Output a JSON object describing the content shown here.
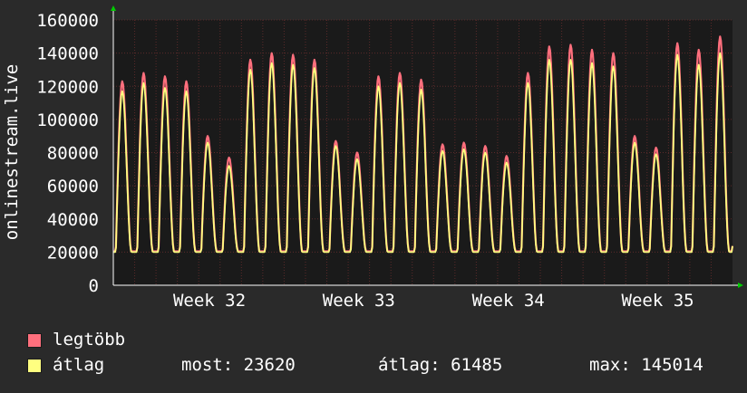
{
  "chart_data": {
    "type": "line",
    "ylabel": "onlinestream.live",
    "ylim": [
      0,
      160000
    ],
    "yticks": [
      0,
      20000,
      40000,
      60000,
      80000,
      100000,
      120000,
      140000,
      160000
    ],
    "xticks": [
      "Week 32",
      "Week 33",
      "Week 34",
      "Week 35"
    ],
    "grid": true,
    "daily_peaks": {
      "series": [
        {
          "name": "legtöbb",
          "color": "#ff6f7d",
          "values": [
            123000,
            128000,
            126000,
            123000,
            90000,
            77000,
            136000,
            140000,
            139000,
            136000,
            87000,
            80000,
            126000,
            128000,
            124000,
            85000,
            86000,
            84000,
            78000,
            128000,
            144000,
            145000,
            142000,
            140000,
            90000,
            83000,
            146000,
            142000,
            150000
          ]
        },
        {
          "name": "átlag",
          "color": "#ffff80",
          "values": [
            117000,
            122000,
            119000,
            117000,
            86000,
            72000,
            130000,
            134000,
            133000,
            131000,
            84000,
            76000,
            120000,
            122000,
            118000,
            81000,
            82000,
            80000,
            74000,
            122000,
            136000,
            136000,
            134000,
            132000,
            86000,
            79000,
            139000,
            133000,
            140000
          ]
        }
      ]
    },
    "daily_min": 20000,
    "last_value": 23620
  },
  "legend": {
    "items": [
      {
        "label": "legtöbb",
        "color": "#ff6f7d"
      },
      {
        "label": "átlag",
        "color": "#ffff80"
      }
    ],
    "stats": {
      "now": "most: 23620",
      "avg": "átlag: 61485",
      "max": "max: 145014"
    }
  },
  "colors": {
    "background": "#2a2a2a",
    "plot_background": "#1a1a1a",
    "grid": "#5a2a2a",
    "axis": "#ffffff",
    "arrow": "#00cc00"
  }
}
